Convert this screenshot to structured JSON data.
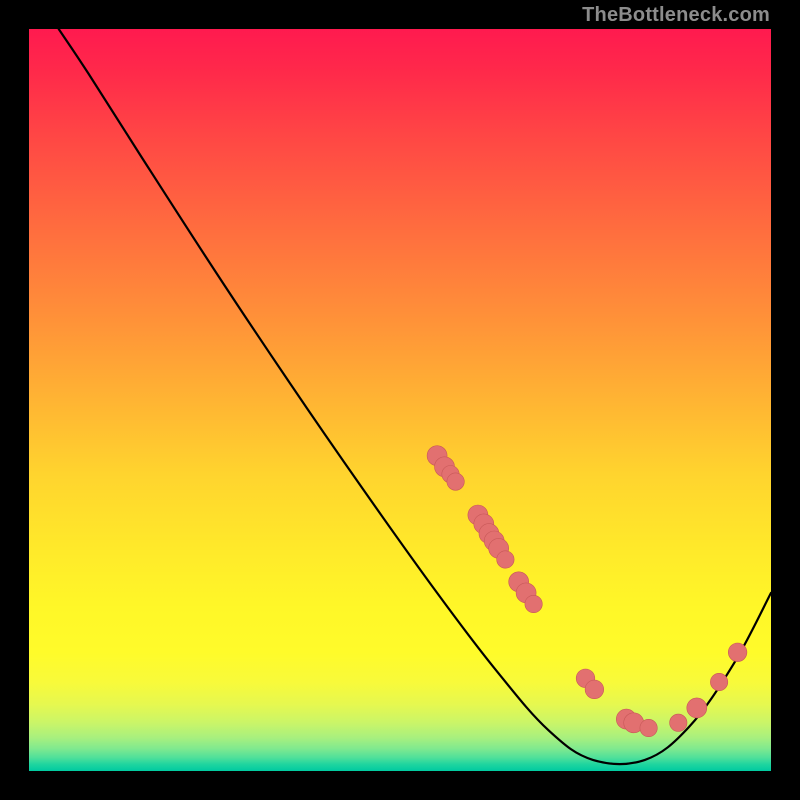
{
  "attribution": "TheBottleneck.com",
  "chart_data": {
    "type": "line",
    "title": "",
    "xlabel": "",
    "ylabel": "",
    "xlim": [
      0,
      100
    ],
    "ylim": [
      0,
      100
    ],
    "grid": false,
    "legend": false,
    "curve_points": [
      {
        "x": 4.0,
        "y": 100.0
      },
      {
        "x": 8.0,
        "y": 94.0
      },
      {
        "x": 15.0,
        "y": 83.0
      },
      {
        "x": 25.0,
        "y": 67.5
      },
      {
        "x": 35.0,
        "y": 52.5
      },
      {
        "x": 45.0,
        "y": 38.0
      },
      {
        "x": 55.0,
        "y": 24.0
      },
      {
        "x": 63.0,
        "y": 13.5
      },
      {
        "x": 70.0,
        "y": 5.5
      },
      {
        "x": 76.0,
        "y": 1.5
      },
      {
        "x": 83.0,
        "y": 1.5
      },
      {
        "x": 89.0,
        "y": 6.0
      },
      {
        "x": 95.0,
        "y": 14.5
      },
      {
        "x": 100.0,
        "y": 24.0
      }
    ],
    "markers": [
      {
        "x": 55.0,
        "y": 42.5,
        "r": 1.5
      },
      {
        "x": 56.0,
        "y": 41.0,
        "r": 1.5
      },
      {
        "x": 56.8,
        "y": 40.0,
        "r": 1.3
      },
      {
        "x": 57.5,
        "y": 39.0,
        "r": 1.3
      },
      {
        "x": 60.5,
        "y": 34.5,
        "r": 1.5
      },
      {
        "x": 61.3,
        "y": 33.3,
        "r": 1.5
      },
      {
        "x": 62.0,
        "y": 32.0,
        "r": 1.5
      },
      {
        "x": 62.7,
        "y": 31.0,
        "r": 1.5
      },
      {
        "x": 63.3,
        "y": 30.0,
        "r": 1.5
      },
      {
        "x": 64.2,
        "y": 28.5,
        "r": 1.3
      },
      {
        "x": 66.0,
        "y": 25.5,
        "r": 1.5
      },
      {
        "x": 67.0,
        "y": 24.0,
        "r": 1.5
      },
      {
        "x": 68.0,
        "y": 22.5,
        "r": 1.3
      },
      {
        "x": 75.0,
        "y": 12.5,
        "r": 1.4
      },
      {
        "x": 76.2,
        "y": 11.0,
        "r": 1.4
      },
      {
        "x": 80.5,
        "y": 7.0,
        "r": 1.5
      },
      {
        "x": 81.5,
        "y": 6.5,
        "r": 1.5
      },
      {
        "x": 83.5,
        "y": 5.8,
        "r": 1.3
      },
      {
        "x": 87.5,
        "y": 6.5,
        "r": 1.3
      },
      {
        "x": 90.0,
        "y": 8.5,
        "r": 1.5
      },
      {
        "x": 93.0,
        "y": 12.0,
        "r": 1.3
      },
      {
        "x": 95.5,
        "y": 16.0,
        "r": 1.4
      }
    ],
    "colors": {
      "curve": "#000000",
      "marker_fill": "#e27070",
      "marker_stroke": "#c85858"
    }
  }
}
